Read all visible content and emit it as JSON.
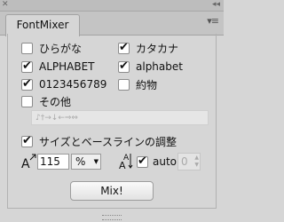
{
  "window": {
    "tab_title": "FontMixer"
  },
  "checkboxes": [
    {
      "label": "ひらがな",
      "checked": false
    },
    {
      "label": "カタカナ",
      "checked": true
    },
    {
      "label": "ALPHABET",
      "checked": true
    },
    {
      "label": "alphabet",
      "checked": true
    },
    {
      "label": "0123456789",
      "checked": true
    },
    {
      "label": "約物",
      "checked": false
    },
    {
      "label": "その他",
      "checked": false
    }
  ],
  "other_chars": {
    "value": "♪†→↓←⇒⇔"
  },
  "adjust": {
    "label": "サイズとベースラインの調整",
    "checked": true
  },
  "size": {
    "value": "115",
    "unit": "%"
  },
  "baseline": {
    "auto_label": "auto",
    "auto_checked": true,
    "value": "0"
  },
  "mix_button": {
    "label": "Mix!"
  }
}
